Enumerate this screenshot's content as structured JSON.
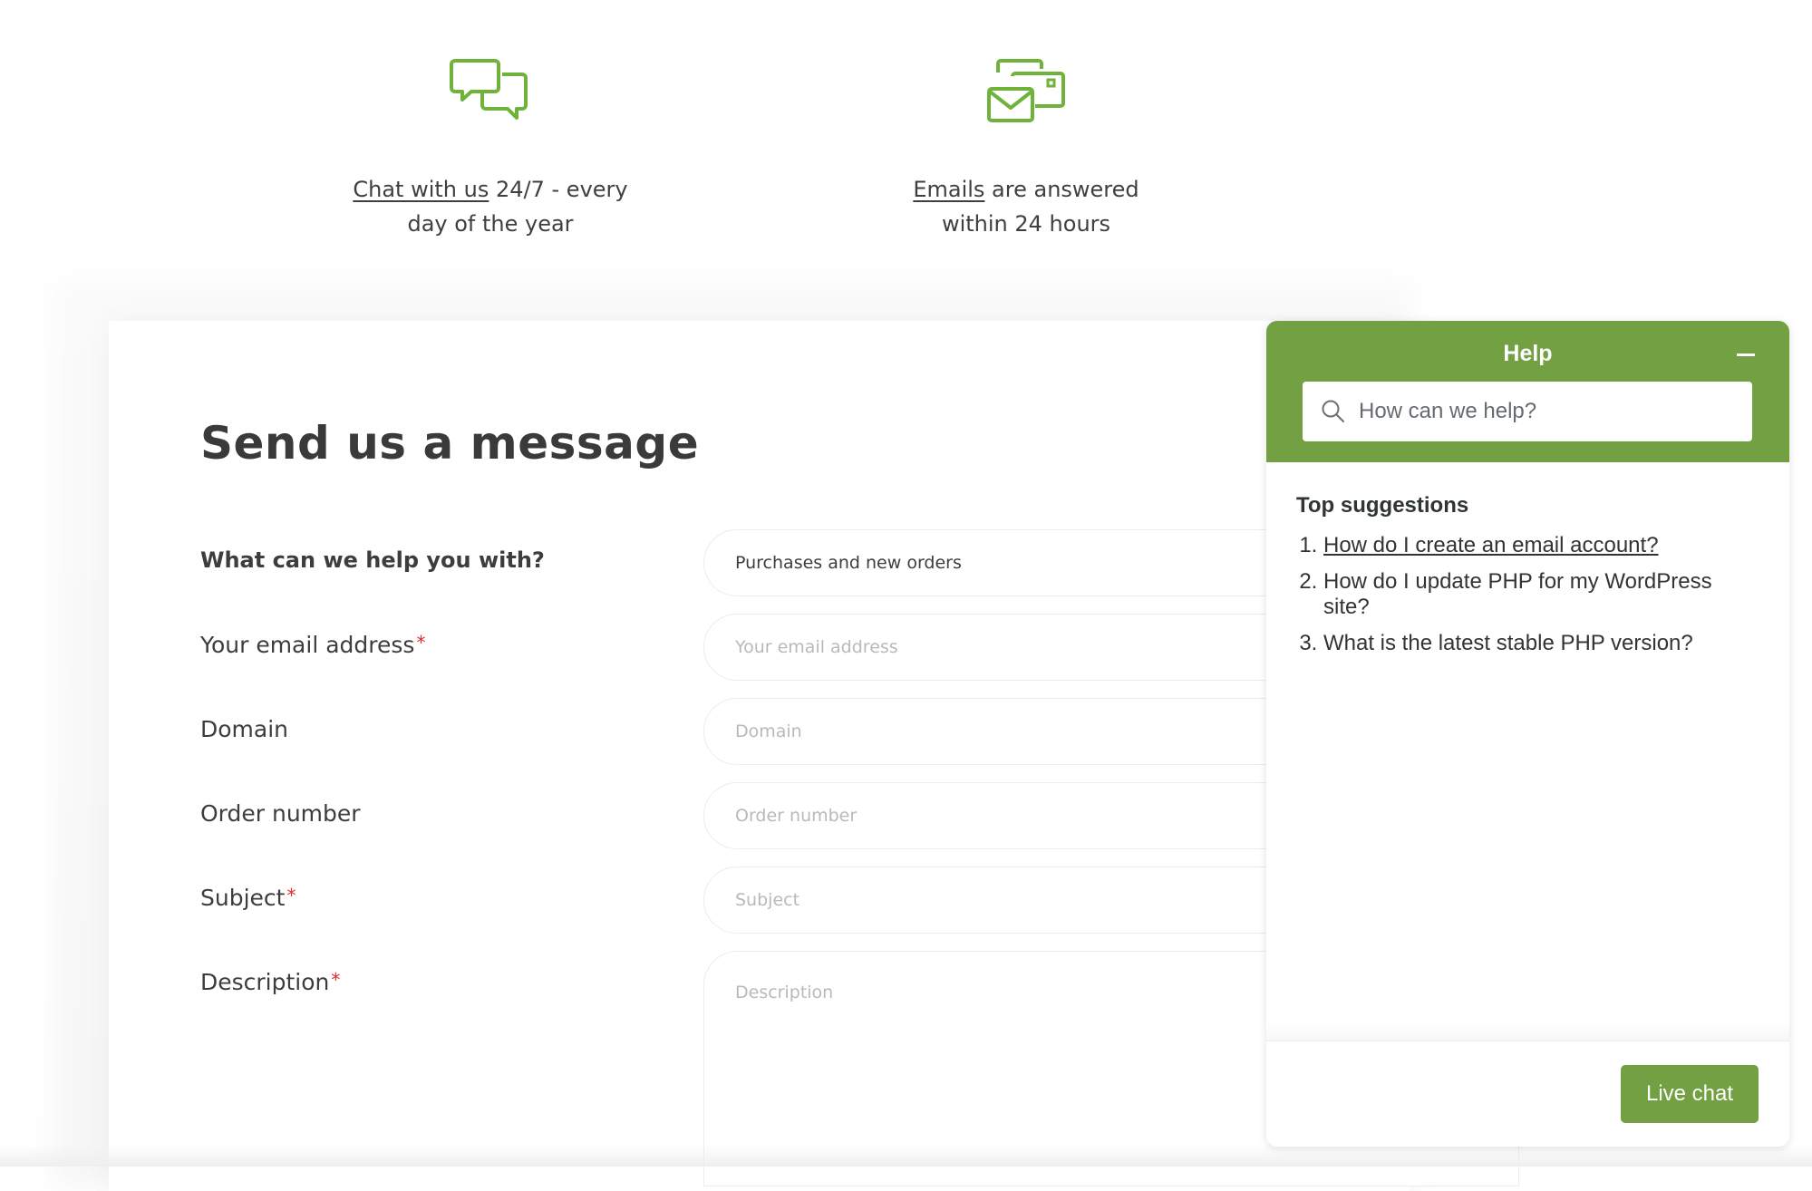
{
  "features": [
    {
      "icon": "chat-bubbles-icon",
      "link_text": "Chat with us",
      "text_after_link": " 24/7 - every",
      "line2": "day of the year"
    },
    {
      "icon": "envelopes-icon",
      "link_text": "Emails",
      "text_after_link": " are answered",
      "line2": "within 24 hours"
    }
  ],
  "form": {
    "title": "Send us a message",
    "fields": [
      {
        "label": "What can we help you with?",
        "required": false,
        "type": "select",
        "value": "Purchases and new orders",
        "placeholder": ""
      },
      {
        "label": "Your email address",
        "required": true,
        "type": "text",
        "value": "",
        "placeholder": "Your email address"
      },
      {
        "label": "Domain",
        "required": false,
        "type": "text",
        "value": "",
        "placeholder": "Domain"
      },
      {
        "label": "Order number",
        "required": false,
        "type": "text",
        "value": "",
        "placeholder": "Order number"
      },
      {
        "label": "Subject",
        "required": true,
        "type": "text",
        "value": "",
        "placeholder": "Subject"
      },
      {
        "label": "Description",
        "required": true,
        "type": "textarea",
        "value": "",
        "placeholder": "Description"
      }
    ],
    "required_marker": "*"
  },
  "help_widget": {
    "title": "Help",
    "minimize_icon": "minus-icon",
    "search_placeholder": "How can we help?",
    "suggestions_heading": "Top suggestions",
    "suggestions": [
      {
        "number": "1.",
        "text": "How do I create an email account?",
        "link": true
      },
      {
        "number": "2.",
        "text": "How do I update PHP for my WordPress site?",
        "link": false
      },
      {
        "number": "3.",
        "text": "What is the latest stable PHP version?",
        "link": false
      }
    ],
    "live_chat_label": "Live chat",
    "accent_color": "#72a042"
  },
  "colors": {
    "brand_green": "#72a042",
    "icon_green": "#6fb33a",
    "required_red": "#e02b2b"
  }
}
